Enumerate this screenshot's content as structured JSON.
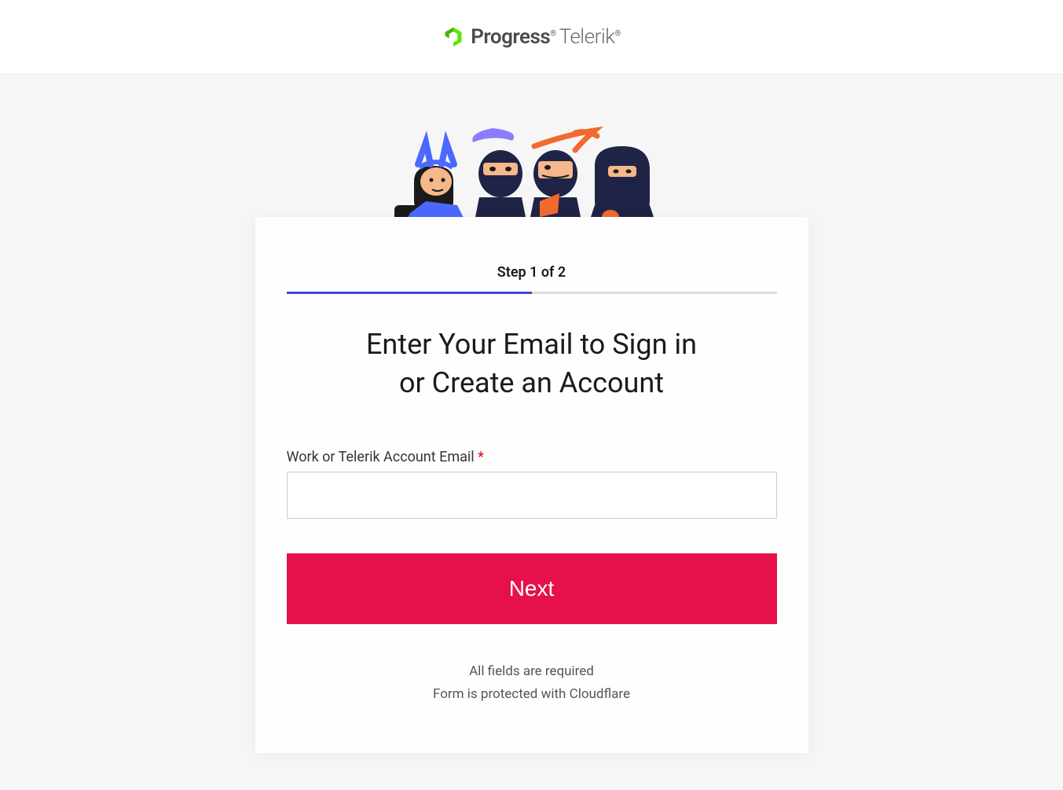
{
  "brand": {
    "name": "Progress",
    "sub": "Telerik"
  },
  "step": {
    "label": "Step 1 of 2"
  },
  "heading": {
    "line1": "Enter Your Email to Sign in",
    "line2": "or Create an Account"
  },
  "form": {
    "email_label": "Work or Telerik Account Email",
    "required_mark": "*",
    "email_value": "",
    "next_button": "Next"
  },
  "footer": {
    "note1": "All fields are required",
    "note2": "Form is protected with Cloudflare"
  }
}
